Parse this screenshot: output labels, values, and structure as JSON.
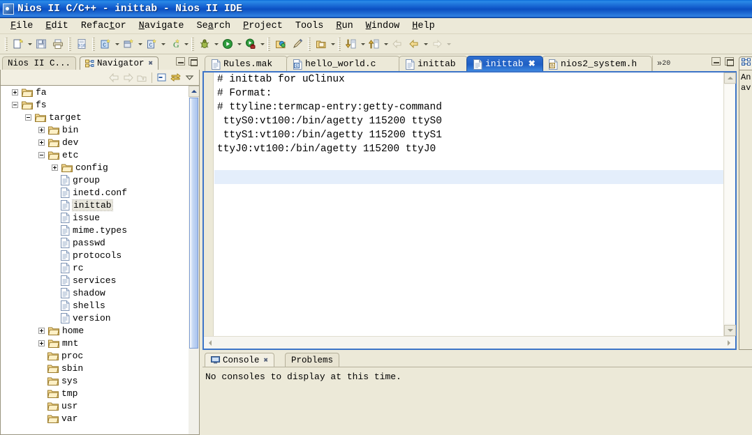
{
  "window": {
    "title": "Nios II C/C++ - inittab - Nios II IDE",
    "app_icon": "eclipse-nios-icon"
  },
  "menubar": {
    "items": [
      {
        "label": "File",
        "mnemonic_index": 0
      },
      {
        "label": "Edit",
        "mnemonic_index": 0
      },
      {
        "label": "Refactor",
        "mnemonic_index": 5
      },
      {
        "label": "Navigate",
        "mnemonic_index": 0
      },
      {
        "label": "Search",
        "mnemonic_index": 2
      },
      {
        "label": "Project",
        "mnemonic_index": 0
      },
      {
        "label": "Tools",
        "mnemonic_index": -1
      },
      {
        "label": "Run",
        "mnemonic_index": 0
      },
      {
        "label": "Window",
        "mnemonic_index": 0
      },
      {
        "label": "Help",
        "mnemonic_index": 0
      }
    ]
  },
  "toolbar": {
    "groups": [
      {
        "buttons": [
          {
            "icon": "new-wizard-icon",
            "dropdown": true
          },
          {
            "icon": "save-icon",
            "dropdown": false
          },
          {
            "icon": "print-icon",
            "dropdown": false
          }
        ]
      },
      {
        "buttons": [
          {
            "icon": "binary-file-icon",
            "dropdown": false
          }
        ]
      },
      {
        "buttons": [
          {
            "icon": "new-c-project-icon",
            "dropdown": true
          },
          {
            "icon": "new-class-icon",
            "dropdown": true
          },
          {
            "icon": "new-c-file-icon",
            "dropdown": true
          },
          {
            "icon": "new-generic-icon",
            "dropdown": true
          }
        ]
      },
      {
        "buttons": [
          {
            "icon": "debug-icon",
            "dropdown": true
          },
          {
            "icon": "run-icon",
            "dropdown": true
          },
          {
            "icon": "run-external-tools-icon",
            "dropdown": true
          }
        ]
      },
      {
        "buttons": [
          {
            "icon": "open-resource-icon",
            "dropdown": false
          },
          {
            "icon": "search-pencil-icon",
            "dropdown": false
          }
        ]
      },
      {
        "buttons": [
          {
            "icon": "open-type-icon",
            "dropdown": true
          }
        ]
      },
      {
        "buttons": [
          {
            "icon": "next-annotation-icon",
            "dropdown": true
          },
          {
            "icon": "previous-annotation-icon",
            "dropdown": true
          }
        ]
      },
      {
        "buttons": [
          {
            "icon": "back-history-icon",
            "dropdown": false
          },
          {
            "icon": "forward-history-icon",
            "dropdown": true
          },
          {
            "icon": "forward-arrow-icon",
            "dropdown": true
          }
        ]
      }
    ]
  },
  "left_pane": {
    "tabs": [
      {
        "label": "Nios II C...",
        "active": false,
        "closable": false,
        "icon": "c-project-icon"
      },
      {
        "label": "Navigator",
        "active": true,
        "closable": true,
        "icon": "navigator-icon"
      }
    ],
    "window_buttons": [
      "minimize",
      "maximize"
    ],
    "view_toolbar": [
      {
        "icon": "back-icon",
        "enabled": false
      },
      {
        "icon": "forward-icon",
        "enabled": false
      },
      {
        "icon": "go-up-icon",
        "enabled": false
      },
      {
        "icon": "collapse-all-icon",
        "enabled": true
      },
      {
        "icon": "link-with-editor-icon",
        "enabled": true
      },
      {
        "icon": "view-menu-icon",
        "enabled": true
      }
    ],
    "tree": [
      {
        "label": "fa",
        "depth": 0,
        "type": "folder",
        "expander": "plus",
        "selected": false
      },
      {
        "label": "fs",
        "depth": 0,
        "type": "folder",
        "expander": "minus",
        "selected": false
      },
      {
        "label": "target",
        "depth": 1,
        "type": "folder",
        "expander": "minus",
        "selected": false
      },
      {
        "label": "bin",
        "depth": 2,
        "type": "folder",
        "expander": "plus",
        "selected": false
      },
      {
        "label": "dev",
        "depth": 2,
        "type": "folder",
        "expander": "plus",
        "selected": false
      },
      {
        "label": "etc",
        "depth": 2,
        "type": "folder",
        "expander": "minus",
        "selected": false
      },
      {
        "label": "config",
        "depth": 3,
        "type": "folder",
        "expander": "plus",
        "selected": false
      },
      {
        "label": "group",
        "depth": 3,
        "type": "file",
        "expander": "none",
        "selected": false
      },
      {
        "label": "inetd.conf",
        "depth": 3,
        "type": "file",
        "expander": "none",
        "selected": false
      },
      {
        "label": "inittab",
        "depth": 3,
        "type": "file",
        "expander": "none",
        "selected": true
      },
      {
        "label": "issue",
        "depth": 3,
        "type": "file",
        "expander": "none",
        "selected": false
      },
      {
        "label": "mime.types",
        "depth": 3,
        "type": "file",
        "expander": "none",
        "selected": false
      },
      {
        "label": "passwd",
        "depth": 3,
        "type": "file",
        "expander": "none",
        "selected": false
      },
      {
        "label": "protocols",
        "depth": 3,
        "type": "file",
        "expander": "none",
        "selected": false
      },
      {
        "label": "rc",
        "depth": 3,
        "type": "file",
        "expander": "none",
        "selected": false
      },
      {
        "label": "services",
        "depth": 3,
        "type": "file",
        "expander": "none",
        "selected": false
      },
      {
        "label": "shadow",
        "depth": 3,
        "type": "file",
        "expander": "none",
        "selected": false
      },
      {
        "label": "shells",
        "depth": 3,
        "type": "file",
        "expander": "none",
        "selected": false
      },
      {
        "label": "version",
        "depth": 3,
        "type": "file",
        "expander": "none",
        "selected": false
      },
      {
        "label": "home",
        "depth": 2,
        "type": "folder",
        "expander": "plus",
        "selected": false
      },
      {
        "label": "mnt",
        "depth": 2,
        "type": "folder",
        "expander": "plus",
        "selected": false
      },
      {
        "label": "proc",
        "depth": 2,
        "type": "folder",
        "expander": "none",
        "selected": false
      },
      {
        "label": "sbin",
        "depth": 2,
        "type": "folder",
        "expander": "none",
        "selected": false
      },
      {
        "label": "sys",
        "depth": 2,
        "type": "folder",
        "expander": "none",
        "selected": false
      },
      {
        "label": "tmp",
        "depth": 2,
        "type": "folder",
        "expander": "none",
        "selected": false
      },
      {
        "label": "usr",
        "depth": 2,
        "type": "folder",
        "expander": "none",
        "selected": false
      },
      {
        "label": "var",
        "depth": 2,
        "type": "folder",
        "expander": "none",
        "selected": false
      }
    ]
  },
  "editor": {
    "tabs": [
      {
        "label": "Rules.mak",
        "icon": "text-file-icon",
        "active": false,
        "closable": false
      },
      {
        "label": "hello_world.c",
        "icon": "c-file-icon",
        "active": false,
        "closable": false
      },
      {
        "label": "inittab",
        "icon": "text-file-icon",
        "active": false,
        "closable": false
      },
      {
        "label": "inittab",
        "icon": "text-file-icon",
        "active": true,
        "closable": true
      },
      {
        "label": "nios2_system.h",
        "icon": "h-file-icon",
        "active": false,
        "closable": false
      }
    ],
    "overflow": {
      "chevron": "»",
      "count": "20"
    },
    "window_buttons": [
      "minimize",
      "maximize"
    ],
    "lines": [
      {
        "text": "# inittab for uClinux",
        "highlighted": false
      },
      {
        "text": "# Format:",
        "highlighted": false
      },
      {
        "text": "# ttyline:termcap-entry:getty-command",
        "highlighted": false
      },
      {
        "text": " ttyS0:vt100:/bin/agetty 115200 ttyS0",
        "highlighted": false
      },
      {
        "text": " ttyS1:vt100:/bin/agetty 115200 ttyS1",
        "highlighted": false
      },
      {
        "text": "ttyJ0:vt100:/bin/agetty 115200 ttyJ0",
        "highlighted": false
      },
      {
        "text": "",
        "highlighted": false
      },
      {
        "text": "",
        "highlighted": true
      },
      {
        "text": "",
        "highlighted": false
      }
    ],
    "current_line_color": "#e4eefb",
    "border_color": "#3c74c8"
  },
  "bottom_view": {
    "tabs": [
      {
        "label": "Console",
        "active": true,
        "closable": true,
        "icon": "console-icon"
      },
      {
        "label": "Problems",
        "active": false,
        "closable": false,
        "icon": ""
      }
    ],
    "message": "No consoles to display at this time."
  },
  "right_pane": {
    "tab_icon": "outline-icon",
    "text_line1": "An",
    "text_line2": "av"
  }
}
